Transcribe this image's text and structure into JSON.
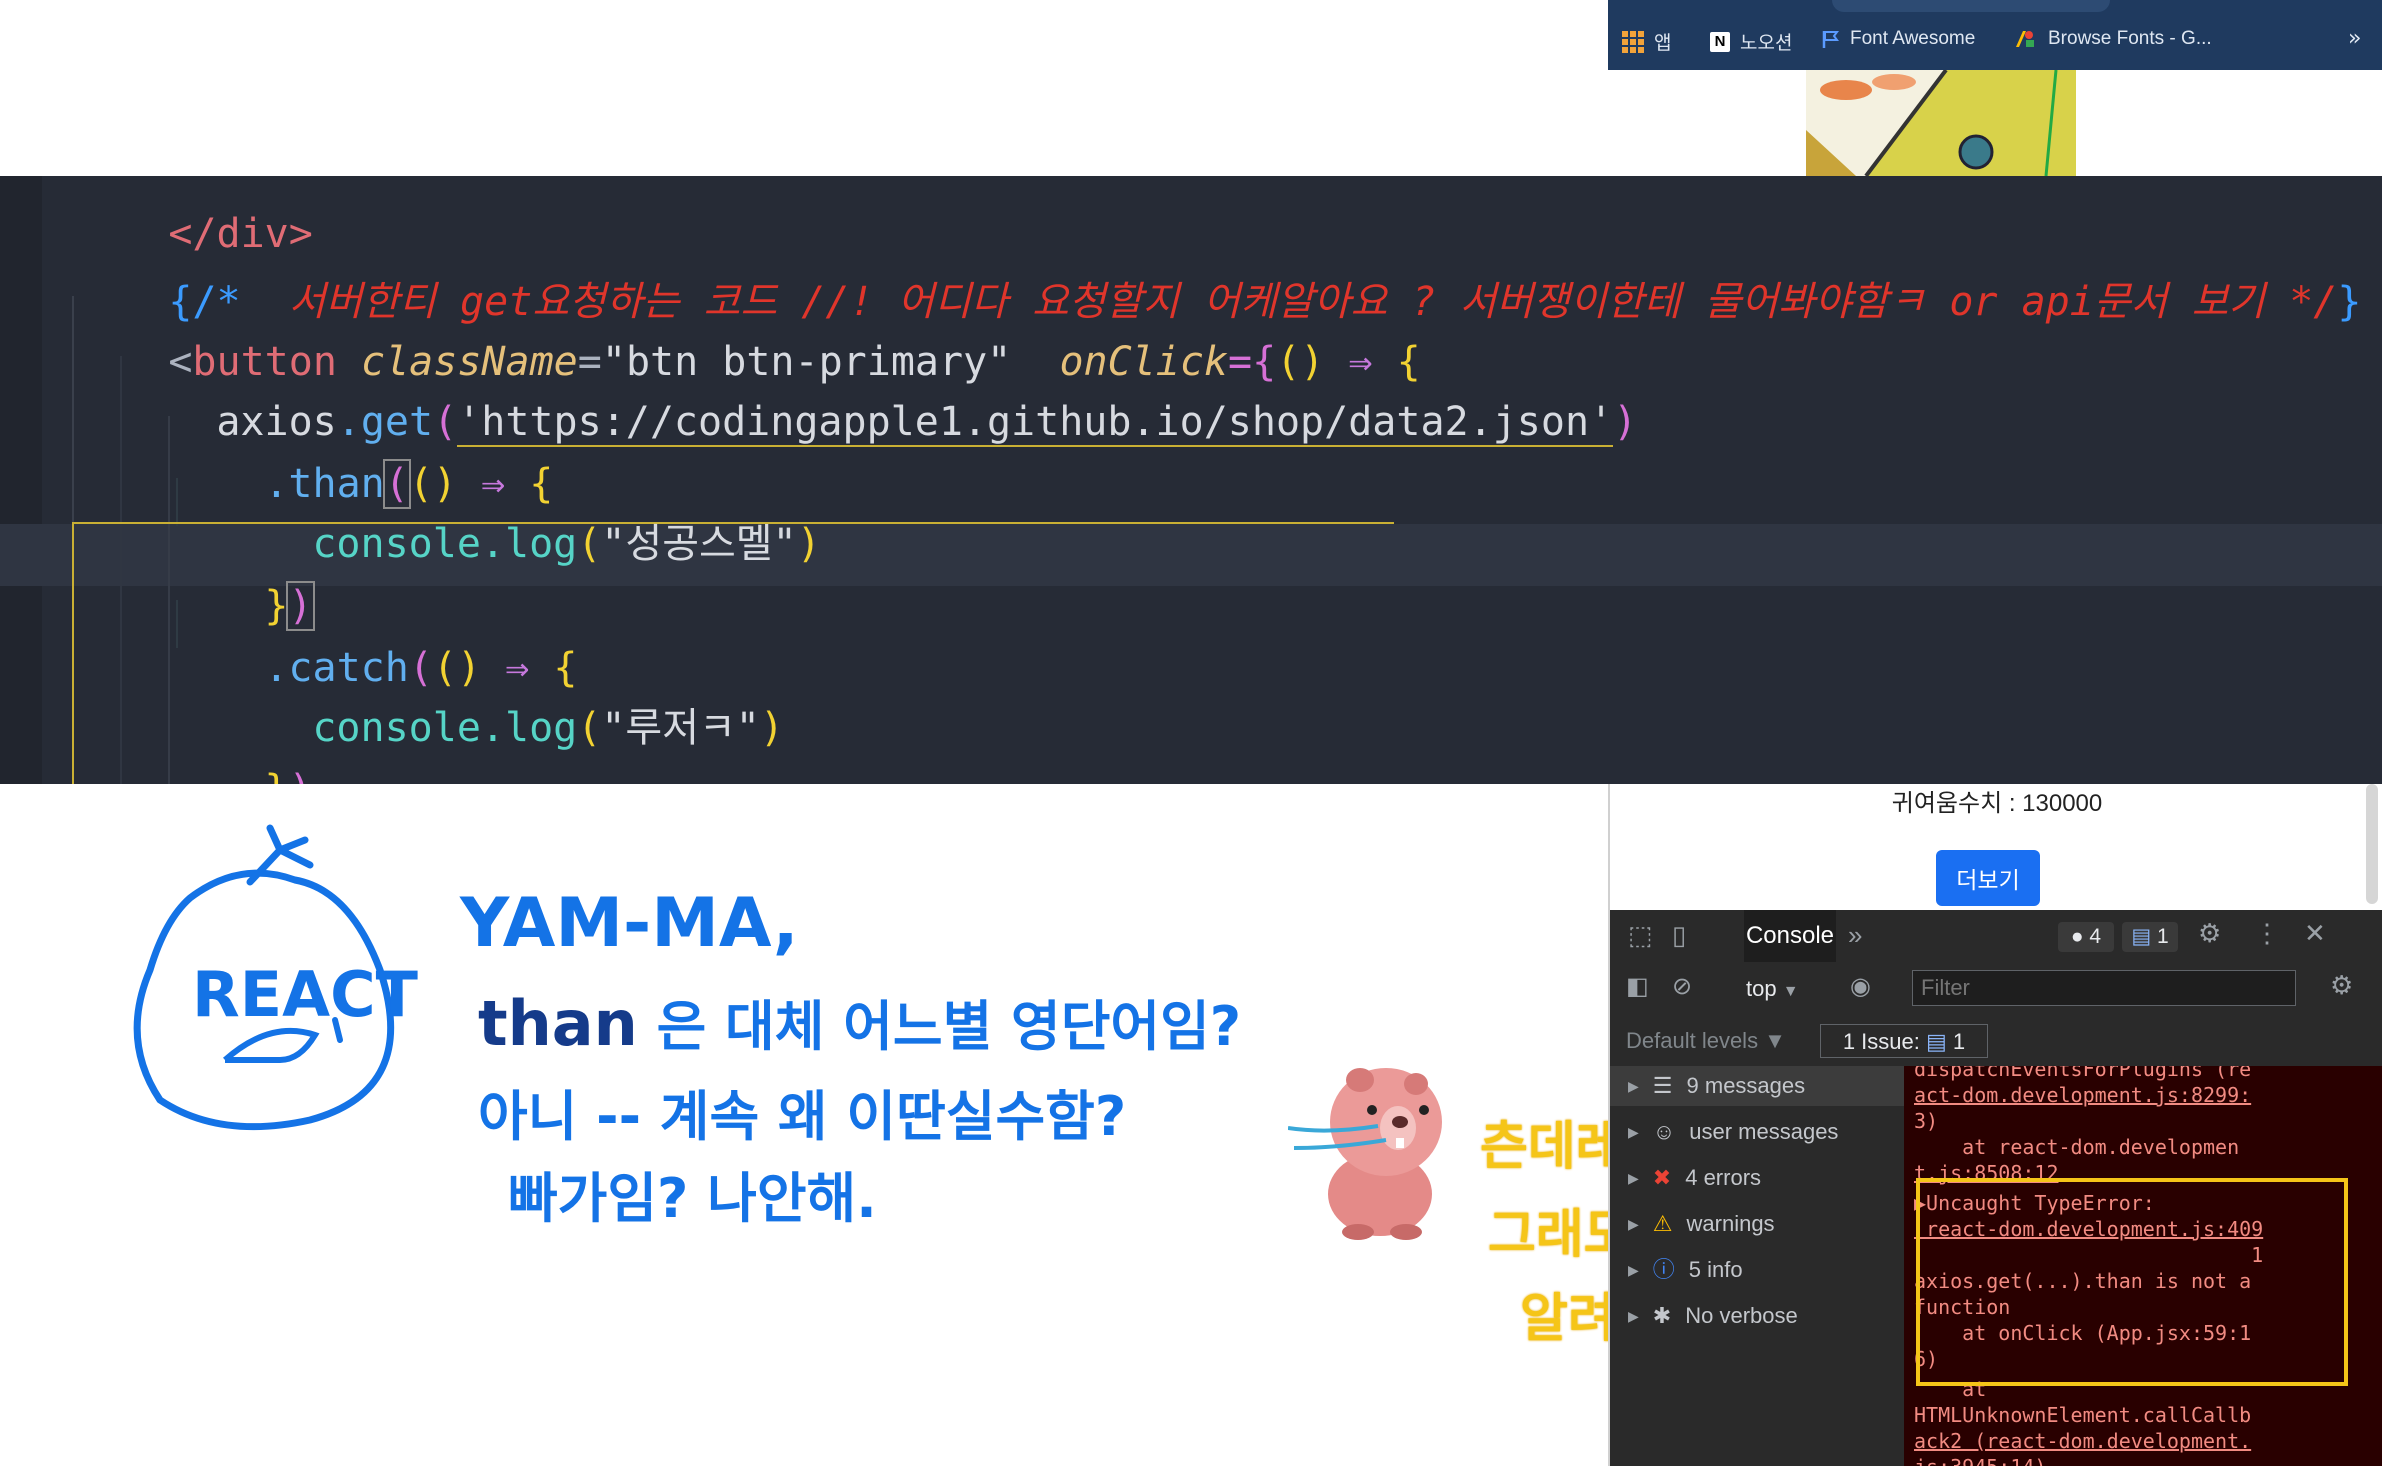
{
  "browser": {
    "bookmarks": [
      {
        "icon": "apps-grid-icon",
        "label": "앱"
      },
      {
        "icon": "notion-icon",
        "label": "노오션"
      },
      {
        "icon": "flag-icon",
        "label": "Font Awesome"
      },
      {
        "icon": "google-fonts-icon",
        "label": "Browse Fonts - G..."
      }
    ],
    "more_glyph": "»"
  },
  "code": {
    "line0": "</div>",
    "comment_open": "{/*",
    "comment_text": "  서버한티 get요청하는 코드 //! 어디다 요청할지 어케알아요 ? 서버쟁이한테 물어봐야함ㅋ or api문서 보기 */",
    "comment_close": "}",
    "btn_open": "<",
    "btn_tag": "button",
    "btn_attr1": "className",
    "btn_eq": "=",
    "btn_val": "\"btn btn-primary\"",
    "btn_attr2": "onClick",
    "btn_eq2": "={",
    "btn_args": "()",
    "arrow": "⇒",
    "open_brace": "{",
    "axios": "axios",
    "dot_get": ".get",
    "url": "'https://codingapple1.github.io/shop/data2.json'",
    "than": ".than",
    "console1": "console.log",
    "str1": "\"성공스멜\"",
    "close1": "})",
    "catch": ".catch",
    "str2": "\"루저ㅋ\"",
    "close2": "})"
  },
  "handwriting": {
    "react_logo_text": "REACT",
    "line1": "YAM-MA,",
    "line2_a": "than",
    "line2_b": "은 대체 어느별 영단어임?",
    "line3": "아니 -- 계속 왜 이딴실수함?",
    "line4": "빠가임?  나안해.",
    "yellow1": "츤데레 리액트...",
    "yellow2": "그래도 뭐 틀렸는지",
    "yellow3": "알려줌ㅋㅋ"
  },
  "page": {
    "cute_value": "귀여움수치 : 130000",
    "more_button": "더보기"
  },
  "devtools": {
    "console_tab": "Console",
    "more_tabs": "»",
    "error_badge": "4",
    "issue_badge": "1",
    "context": "top",
    "filter_placeholder": "Filter",
    "levels": "Default levels ▼",
    "issues": "1 Issue:",
    "issues_count": "1",
    "sidebar": [
      {
        "label": "9 messages",
        "icon": "list-icon"
      },
      {
        "label": "user messages",
        "icon": "user-icon"
      },
      {
        "label": "4 errors",
        "icon": "error-icon"
      },
      {
        "label": "warnings",
        "icon": "warning-icon"
      },
      {
        "label": "5 info",
        "icon": "info-icon"
      },
      {
        "label": "No verbose",
        "icon": "bug-icon"
      }
    ],
    "log": {
      "l1": "dispatchEventsForPlugins (re",
      "l2": "act-dom.development.js:8299:",
      "l3": "3)",
      "l4": "    at react-dom.developmen",
      "l5": "t.js:8508:12",
      "l6": "▶Uncaught TypeError:",
      "l7": " react-dom.development.js:409",
      "l8": "                            1",
      "l9": "axios.get(...).than is not a",
      "l10": "function",
      "l11": "    at onClick (App.jsx:59:1",
      "l12": "6)",
      "l13": "    at",
      "l14": "HTMLUnknownElement.callCallb",
      "l15": "ack2 (react-dom.development.",
      "l16": "js:3945:14)"
    }
  },
  "colors": {
    "code_bg": "#262b36",
    "comment": "#e0352b",
    "hand_blue": "#1473e6",
    "hand_yellow": "#f5c518",
    "button_blue": "#1a6ff2"
  }
}
